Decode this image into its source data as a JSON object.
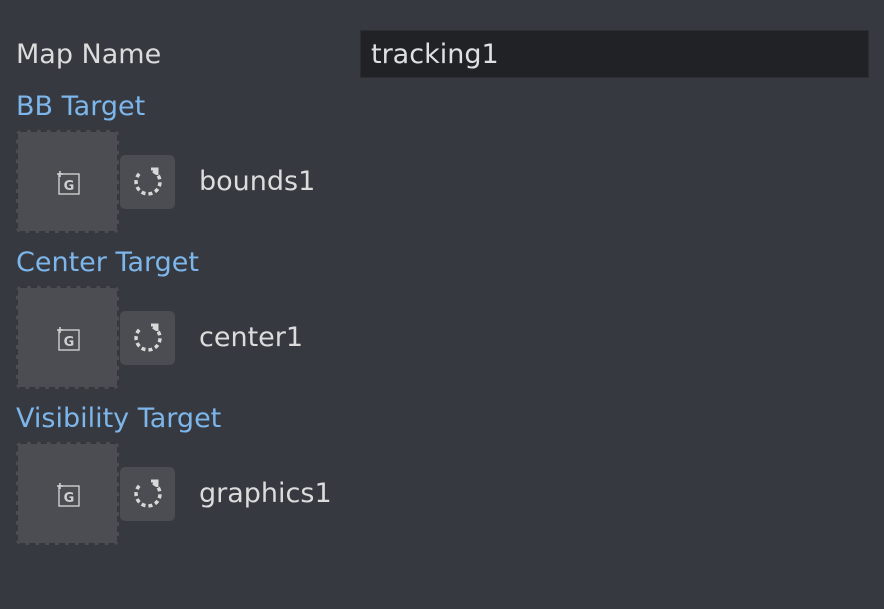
{
  "map": {
    "label": "Map Name",
    "value": "tracking1"
  },
  "targets": [
    {
      "title": "BB Target",
      "value": "bounds1",
      "drop_icon": "add-graphic-icon",
      "reset_icon": "reset-icon"
    },
    {
      "title": "Center Target",
      "value": "center1",
      "drop_icon": "add-graphic-icon",
      "reset_icon": "reset-icon"
    },
    {
      "title": "Visibility Target",
      "value": "graphics1",
      "drop_icon": "add-graphic-icon",
      "reset_icon": "reset-icon"
    }
  ],
  "colors": {
    "background": "#363940",
    "section_title": "#7db6ea",
    "input_background": "#202226",
    "tile_background": "#4b4d52"
  }
}
